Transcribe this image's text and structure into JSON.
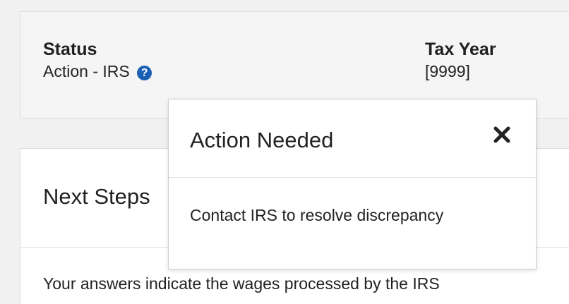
{
  "status_panel": {
    "status_heading": "Status",
    "status_value": "Action - IRS",
    "help_icon": "question-circle-icon",
    "help_glyph": "?",
    "tax_year_heading": "Tax Year",
    "tax_year_value": "[9999]"
  },
  "card": {
    "title": "Next Steps",
    "body_text": "Your answers indicate the wages processed by the IRS"
  },
  "popover": {
    "title": "Action Needed",
    "close_icon": "close-x-icon",
    "body_text": "Contact IRS to resolve discrepancy"
  },
  "colors": {
    "help_icon_bg": "#1a5fb4",
    "panel_bg": "#f5f5f5",
    "page_bg": "#f1f1f1"
  }
}
